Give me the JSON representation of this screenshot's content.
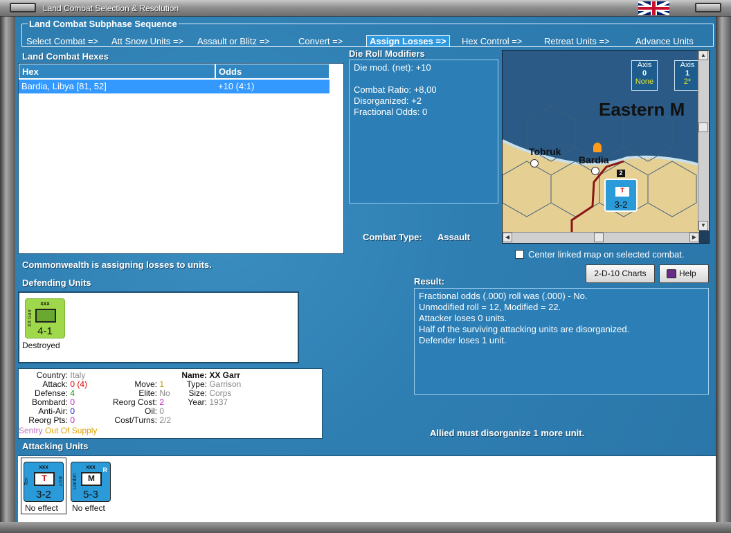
{
  "window": {
    "title": "Land Combat Selection & Resolution"
  },
  "subphase": {
    "title": "Land Combat Subphase Sequence",
    "steps": [
      "Select Combat =>",
      "Att Snow Units =>",
      "Assault or Blitz =>",
      "Convert =>",
      "Assign Losses =>",
      "Hex Control =>",
      "Retreat Units =>",
      "Advance Units"
    ],
    "active_step": "Assign Losses =>"
  },
  "hexes": {
    "title": "Land Combat Hexes",
    "columns": [
      "Hex",
      "Odds"
    ],
    "rows": [
      {
        "hex": "Bardia, Libya [81, 52]",
        "odds": "+10 (4:1)"
      }
    ]
  },
  "modifiers": {
    "title": "Die Roll Modifiers",
    "net": "Die mod. (net): +10",
    "ratio": "Combat Ratio: +8,00",
    "disorganized": "Disorganized: +2",
    "fractional": "Fractional Odds: 0"
  },
  "map": {
    "region_label": "Eastern M",
    "city1": "Tobruk",
    "city2": "Bardia",
    "stack_count": "2",
    "axis1": {
      "label": "Axis",
      "value": "0",
      "sub": "None"
    },
    "axis2": {
      "label": "Axis",
      "value": "1",
      "sub": "2*"
    },
    "unit_value": "3-2",
    "unit_letter": "T"
  },
  "combat_type": {
    "label": "Combat Type:",
    "value": "Assault"
  },
  "center_map_label": "Center linked map on selected combat.",
  "buttons": {
    "charts": "2-D-10 Charts",
    "help": "Help"
  },
  "status_message": "Commonwealth is assigning losses to units.",
  "defending": {
    "title": "Defending Units",
    "units": [
      {
        "side_label": "XX Garr",
        "xxx": "xxx",
        "value": "4-1",
        "status": "Destroyed",
        "color": "#9fd84a"
      }
    ]
  },
  "unit_stats": {
    "country_k": "Country:",
    "country_v": "Italy",
    "attack_k": "Attack:",
    "attack_v": "0",
    "attack_v2": "(4)",
    "defense_k": "Defense:",
    "defense_v": "4",
    "bombard_k": "Bombard:",
    "bombard_v": "0",
    "antiair_k": "Anti-Air:",
    "antiair_v": "0",
    "reorgpts_k": "Reorg Pts:",
    "reorgpts_v": "0",
    "move_k": "Move:",
    "move_v": "1",
    "elite_k": "Elite:",
    "elite_v": "No",
    "reorgcost_k": "Reorg Cost:",
    "reorgcost_v": "2",
    "oil_k": "Oil:",
    "oil_v": "0",
    "costturns_k": "Cost/Turns:",
    "costturns_v": "2/2",
    "name_k": "Name:",
    "name_v": "XX Garr",
    "type_k": "Type:",
    "type_v": "Garrison",
    "size_k": "Size:",
    "size_v": "Corps",
    "year_k": "Year:",
    "year_v": "1937",
    "sentry": "Sentry",
    "supply": "Out Of Supply"
  },
  "result": {
    "title": "Result:",
    "lines": [
      "Fractional odds (.000) roll was (.000)  - No.",
      "Unmodified roll = 12, Modified = 22.",
      "Attacker loses 0 units.",
      "Half of the surviving attacking units are disorganized.",
      "Defender loses 1 unit."
    ]
  },
  "allied_message": "Allied must disorganize 1 more unit.",
  "attacking": {
    "title": "Attacking Units",
    "units": [
      {
        "side_label": "Ten",
        "right_label": "EGY",
        "xxx": "xxx",
        "letter": "T",
        "value": "3-2",
        "status": "No effect",
        "color": "#2a9ad8"
      },
      {
        "side_label": "London",
        "right_label": "R",
        "xxx": "xxx",
        "letter": "M",
        "value": "5-3",
        "status": "No effect",
        "color": "#2a9ad8"
      }
    ]
  }
}
